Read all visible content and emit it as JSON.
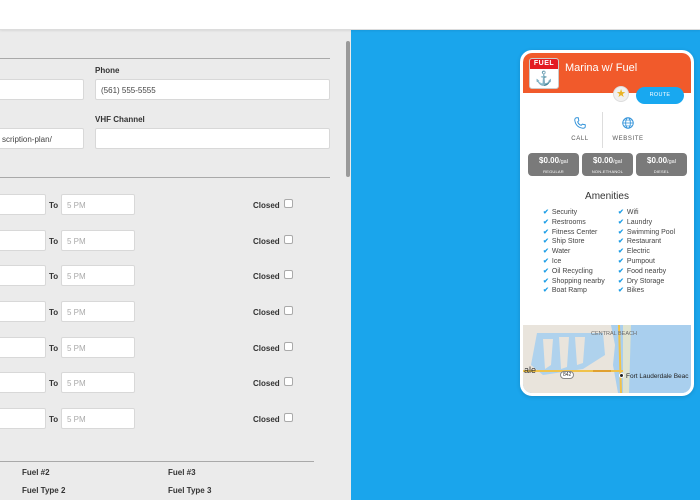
{
  "form": {
    "phone_label": "Phone",
    "phone_value": "(561) 555-5555",
    "website_value": "scription-plan/",
    "vhf_label": "VHF Channel",
    "vhf_value": "",
    "to_label": "To",
    "to_placeholder": "5 PM",
    "closed_label": "Closed",
    "fuel2_label": "Fuel #2",
    "fuel3_label": "Fuel #3",
    "fueltype2_label": "Fuel Type 2",
    "fueltype3_label": "Fuel Type 3"
  },
  "card": {
    "logo_text": "FUEL",
    "title": "Marina w/ Fuel",
    "route_label": "ROUTE",
    "call_label": "CALL",
    "website_label": "WEBSITE",
    "prices": [
      {
        "amount": "$0.00",
        "unit": "/gal",
        "type": "REGULAR"
      },
      {
        "amount": "$0.00",
        "unit": "/gal",
        "type": "NON-ETHANOL"
      },
      {
        "amount": "$0.00",
        "unit": "/gal",
        "type": "DIESEL"
      }
    ],
    "amenities_title": "Amenities",
    "amenities_left": [
      "Security",
      "Restrooms",
      "Fitness Center",
      "Ship Store",
      "Water",
      "Ice",
      "Oil Recycling",
      "Shopping nearby",
      "Boat Ramp"
    ],
    "amenities_right": [
      "Wifi",
      "Laundry",
      "Swimming Pool",
      "Restaurant",
      "Electric",
      "Pumpout",
      "Food nearby",
      "Dry Storage",
      "Bikes"
    ],
    "map": {
      "label_beach": "CENTRAL BEACH",
      "label_city": "Fort Lauderdale Beac",
      "label_left": "ale",
      "road_number": "842"
    }
  },
  "colors": {
    "header": "#f15a2b",
    "accent": "#18a8f0",
    "background": "#1aa5ec"
  }
}
